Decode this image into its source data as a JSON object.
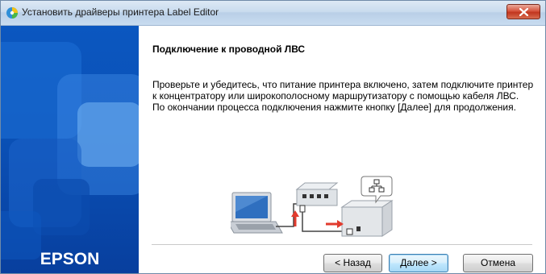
{
  "window": {
    "title": "Установить драйверы принтера Label Editor"
  },
  "sidebar": {
    "brand": "EPSON"
  },
  "content": {
    "heading": "Подключение к проводной ЛВС",
    "paragraph1": "Проверьте и убедитесь, что питание принтера включено, затем подключите принтер к концентратору или широкополосному маршрутизатору с помощью кабеля ЛВС.",
    "paragraph2": "По окончании процесса подключения нажмите кнопку [Далее] для продолжения."
  },
  "buttons": {
    "back": "< Назад",
    "next": "Далее >",
    "cancel": "Отмена"
  },
  "colors": {
    "sidebar_blue": "#0a4fb4",
    "arrow_red": "#e23b2e",
    "close_red": "#c1361f"
  },
  "icons": [
    "app-installer-icon",
    "close-icon",
    "laptop-icon",
    "network-hub-icon",
    "printer-icon",
    "network-speech-bubble-icon",
    "up-arrow-icon",
    "right-arrow-icon"
  ]
}
